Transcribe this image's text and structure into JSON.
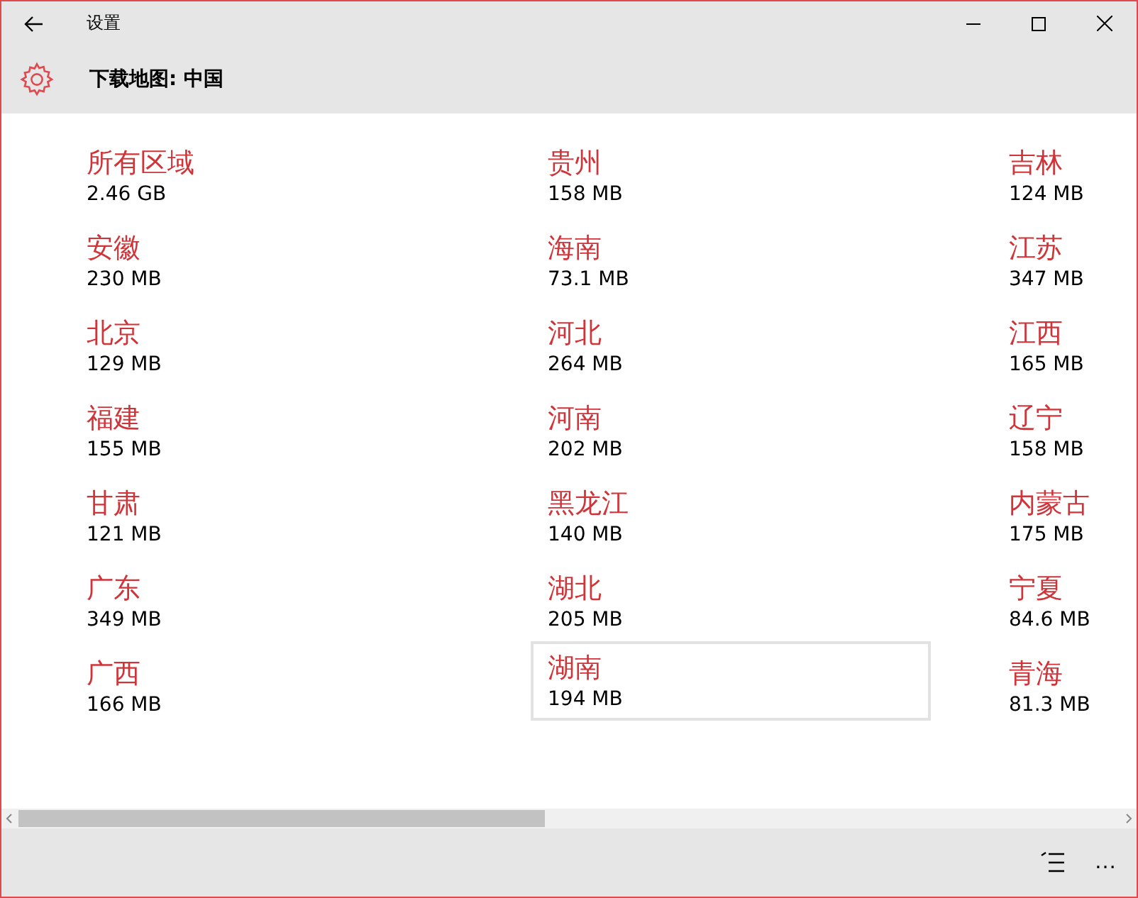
{
  "window": {
    "title": "设置"
  },
  "header": {
    "title": "下载地图: 中国"
  },
  "regions": [
    {
      "name": "所有区域",
      "size": "2.46 GB",
      "selected": false
    },
    {
      "name": "安徽",
      "size": "230 MB",
      "selected": false
    },
    {
      "name": "北京",
      "size": "129 MB",
      "selected": false
    },
    {
      "name": "福建",
      "size": "155 MB",
      "selected": false
    },
    {
      "name": "甘肃",
      "size": "121 MB",
      "selected": false
    },
    {
      "name": "广东",
      "size": "349 MB",
      "selected": false
    },
    {
      "name": "广西",
      "size": "166 MB",
      "selected": false
    },
    {
      "name": "贵州",
      "size": "158 MB",
      "selected": false
    },
    {
      "name": "海南",
      "size": "73.1 MB",
      "selected": false
    },
    {
      "name": "河北",
      "size": "264 MB",
      "selected": false
    },
    {
      "name": "河南",
      "size": "202 MB",
      "selected": false
    },
    {
      "name": "黑龙江",
      "size": "140 MB",
      "selected": false
    },
    {
      "name": "湖北",
      "size": "205 MB",
      "selected": false
    },
    {
      "name": "湖南",
      "size": "194 MB",
      "selected": true
    },
    {
      "name": "吉林",
      "size": "124 MB",
      "selected": false
    },
    {
      "name": "江苏",
      "size": "347 MB",
      "selected": false
    },
    {
      "name": "江西",
      "size": "165 MB",
      "selected": false
    },
    {
      "name": "辽宁",
      "size": "158 MB",
      "selected": false
    },
    {
      "name": "内蒙古",
      "size": "175 MB",
      "selected": false
    },
    {
      "name": "宁夏",
      "size": "84.6 MB",
      "selected": false
    },
    {
      "name": "青海",
      "size": "81.3 MB",
      "selected": false
    }
  ],
  "bottom_bar": {
    "more": "…"
  }
}
